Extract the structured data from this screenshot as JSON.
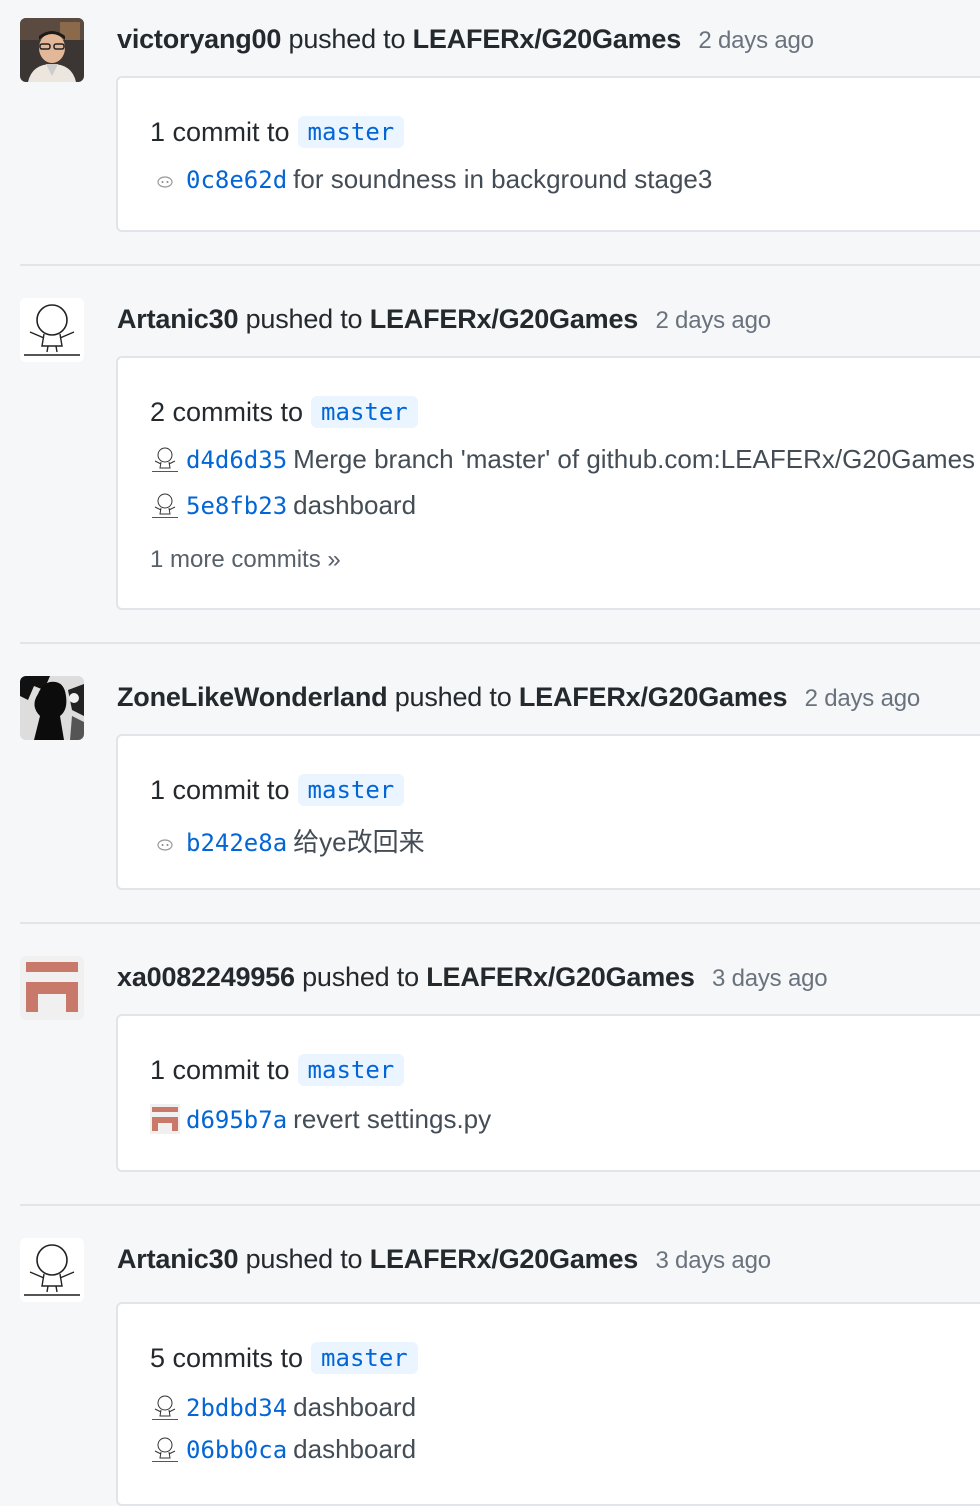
{
  "events": [
    {
      "user": "victoryang00",
      "verb": "pushed to",
      "repo": "LEAFERx/G20Games",
      "time": "2 days ago",
      "avatar": "photo-avatar",
      "summary": "1 commit to",
      "branch": "master",
      "commits": [
        {
          "sha": "0c8e62d",
          "message": "for soundness in background stage3",
          "avatar": "tiny-face-icon"
        }
      ]
    },
    {
      "user": "Artanic30",
      "verb": "pushed to",
      "repo": "LEAFERx/G20Games",
      "time": "2 days ago",
      "avatar": "sketch-figure-avatar",
      "summary": "2 commits to",
      "branch": "master",
      "commits": [
        {
          "sha": "d4d6d35",
          "message": "Merge branch 'master' of github.com:LEAFERx/G20Games",
          "avatar": "sketch-figure-icon"
        },
        {
          "sha": "5e8fb23",
          "message": "dashboard",
          "avatar": "sketch-figure-icon"
        }
      ],
      "more": "1 more commits »"
    },
    {
      "user": "ZoneLikeWonderland",
      "verb": "pushed to",
      "repo": "LEAFERx/G20Games",
      "time": "2 days ago",
      "avatar": "silhouette-avatar",
      "summary": "1 commit to",
      "branch": "master",
      "commits": [
        {
          "sha": "b242e8a",
          "message": "给ye改回来",
          "avatar": "tiny-face-icon"
        }
      ]
    },
    {
      "user": "xa0082249956",
      "verb": "pushed to",
      "repo": "LEAFERx/G20Games",
      "time": "3 days ago",
      "avatar": "identicon-avatar",
      "summary": "1 commit to",
      "branch": "master",
      "commits": [
        {
          "sha": "d695b7a",
          "message": "revert settings.py",
          "avatar": "identicon-icon"
        }
      ]
    },
    {
      "user": "Artanic30",
      "verb": "pushed to",
      "repo": "LEAFERx/G20Games",
      "time": "3 days ago",
      "avatar": "sketch-figure-avatar",
      "summary": "5 commits to",
      "branch": "master",
      "commits": [
        {
          "sha": "2bdbd34",
          "message": "dashboard",
          "avatar": "sketch-figure-icon"
        },
        {
          "sha": "06bb0ca",
          "message": "dashboard",
          "avatar": "sketch-figure-icon"
        }
      ]
    }
  ],
  "colors": {
    "link": "#0366d6",
    "branch_bg": "#eaf5ff",
    "muted": "#6a737d",
    "identicon": "#c9796a"
  }
}
